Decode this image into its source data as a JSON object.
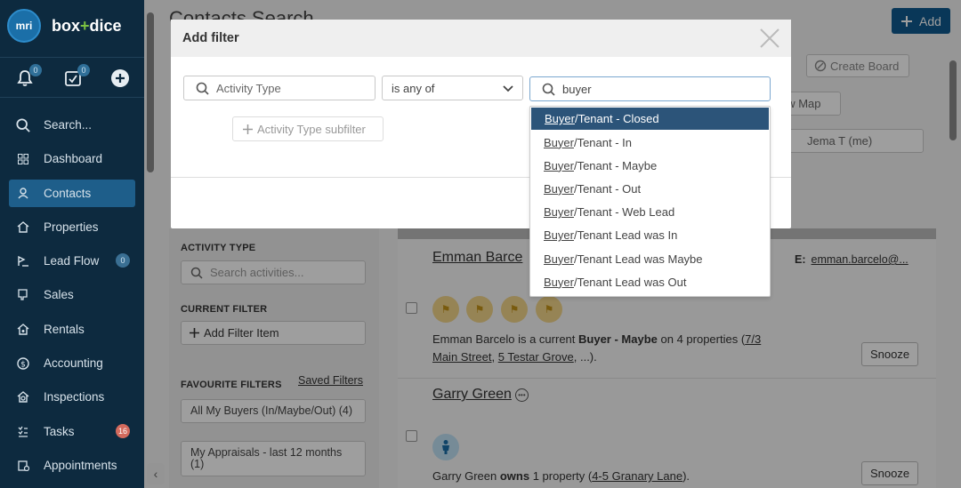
{
  "brand": {
    "logo_text": "mri",
    "name_part1": "box",
    "name_plus": "+",
    "name_part2": "dice"
  },
  "quick": {
    "notifications_count": "0",
    "tasks_count": "0"
  },
  "sidebar": {
    "items": [
      {
        "label": "Search..."
      },
      {
        "label": "Dashboard"
      },
      {
        "label": "Contacts"
      },
      {
        "label": "Properties"
      },
      {
        "label": "Lead Flow",
        "badge": "0"
      },
      {
        "label": "Sales"
      },
      {
        "label": "Rentals"
      },
      {
        "label": "Accounting"
      },
      {
        "label": "Inspections"
      },
      {
        "label": "Tasks",
        "badge": "16"
      },
      {
        "label": "Appointments"
      }
    ],
    "collapse_glyph": "‹"
  },
  "page": {
    "title": "Contacts Search",
    "add_label": "Add",
    "create_board_label": "Create Board",
    "show_map_label": "ow Map",
    "agent_filter_value": "Jema T (me)"
  },
  "left_panel": {
    "activity_type_label": "ACTIVITY TYPE",
    "search_activities_placeholder": "Search activities...",
    "current_filter_label": "CURRENT FILTER",
    "add_filter_item_label": "Add Filter Item",
    "favourite_filters_label": "FAVOURITE FILTERS",
    "saved_filters_link": "Saved Filters",
    "favourites": [
      {
        "label": "All My Buyers (In/Maybe/Out) (4)"
      },
      {
        "label": "My Appraisals - last 12 months (1)"
      }
    ]
  },
  "results": [
    {
      "name": "Emman Barce",
      "email_label": "E:",
      "email": "emman.barcelo@...",
      "desc_pre": "Emman Barcelo is a current ",
      "desc_bold": "Buyer - Maybe",
      "desc_mid": " on 4 properties (",
      "link1": "7/3 Main Street",
      "sep": ", ",
      "link2": "5 Testar Grove",
      "desc_end": ", ...).",
      "snooze_label": "Snooze"
    },
    {
      "name": "Garry Green",
      "desc_pre": "Garry Green ",
      "desc_bold": "owns",
      "desc_mid": " 1 property (",
      "link1": "4-5 Granary Lane",
      "desc_end": ").",
      "snooze_label": "Snooze"
    }
  ],
  "modal": {
    "title": "Add filter",
    "field_placeholder": "Activity Type",
    "operator_value": "is any of",
    "search_value": "buyer",
    "subfilter_label": "Activity Type subfilter"
  },
  "dropdown": {
    "options": [
      {
        "match": "Buyer",
        "rest": "/Tenant - Closed",
        "selected": true
      },
      {
        "match": "Buyer",
        "rest": "/Tenant - In"
      },
      {
        "match": "Buyer",
        "rest": "/Tenant - Maybe"
      },
      {
        "match": "Buyer",
        "rest": "/Tenant - Out"
      },
      {
        "match": "Buyer",
        "rest": "/Tenant - Web Lead"
      },
      {
        "match": "Buyer",
        "rest": "/Tenant Lead was In"
      },
      {
        "match": "Buyer",
        "rest": "/Tenant Lead was Maybe"
      },
      {
        "match": "Buyer",
        "rest": "/Tenant Lead was Out"
      }
    ]
  },
  "colors": {
    "sidebar_bg": "#0d2a3f",
    "active_nav": "#1e5e8a",
    "primary": "#0f5a8e",
    "selected_option": "#2c5479",
    "flag_bg": "#f3d58a"
  },
  "icons": {
    "sidebar": [
      "search-icon",
      "dashboard-icon",
      "contacts-icon",
      "properties-icon",
      "lead-flow-icon",
      "sales-icon",
      "rentals-icon",
      "accounting-icon",
      "inspections-icon",
      "tasks-icon",
      "appointments-icon"
    ]
  }
}
